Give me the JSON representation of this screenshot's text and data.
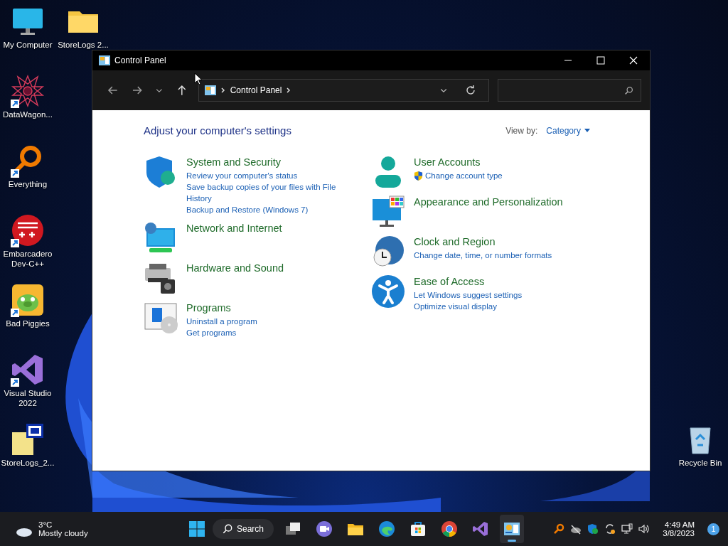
{
  "desktop_icons": [
    {
      "label": "My Computer",
      "kind": "monitor",
      "shortcut": false
    },
    {
      "label": "StoreLogs 2...",
      "kind": "folder",
      "shortcut": false
    },
    {
      "label": "DataWagon...",
      "kind": "star",
      "shortcut": true
    },
    {
      "label": "Everything",
      "kind": "magnifier",
      "shortcut": true
    },
    {
      "label": "Embarcadero Dev-C++",
      "kind": "dev",
      "shortcut": true
    },
    {
      "label": "Bad Piggies",
      "kind": "pig",
      "shortcut": true
    },
    {
      "label": "Visual Studio 2022",
      "kind": "vs",
      "shortcut": true
    },
    {
      "label": "StoreLogs_2...",
      "kind": "doc",
      "shortcut": false
    },
    {
      "label": "Recycle Bin",
      "kind": "bin",
      "shortcut": false
    }
  ],
  "window": {
    "title": "Control Panel",
    "address": {
      "crumbs": [
        "Control Panel"
      ]
    },
    "heading": "Adjust your computer's settings",
    "view_by": {
      "label": "View by:",
      "value": "Category"
    },
    "columns": [
      [
        {
          "title": "System and Security",
          "kind": "shield",
          "links": [
            {
              "text": "Review your computer's status",
              "shield": false
            },
            {
              "text": "Save backup copies of your files with File History",
              "shield": false
            },
            {
              "text": "Backup and Restore (Windows 7)",
              "shield": false
            }
          ]
        },
        {
          "title": "Network and Internet",
          "kind": "network"
        },
        {
          "title": "Hardware and Sound",
          "kind": "printer"
        },
        {
          "title": "Programs",
          "kind": "programs",
          "links": [
            {
              "text": "Uninstall a program",
              "shield": false
            },
            {
              "text": "Get programs",
              "shield": false
            }
          ]
        }
      ],
      [
        {
          "title": "User Accounts",
          "kind": "user",
          "links": [
            {
              "text": "Change account type",
              "shield": true
            }
          ]
        },
        {
          "title": "Appearance and Personalization",
          "kind": "display"
        },
        {
          "title": "Clock and Region",
          "kind": "clock",
          "links": [
            {
              "text": "Change date, time, or number formats",
              "shield": false
            }
          ]
        },
        {
          "title": "Ease of Access",
          "kind": "access",
          "links": [
            {
              "text": "Let Windows suggest settings",
              "shield": false
            },
            {
              "text": "Optimize visual display",
              "shield": false
            }
          ]
        }
      ]
    ]
  },
  "taskbar": {
    "weather": {
      "temperature": "3°C",
      "condition": "Mostly cloudy"
    },
    "search_label": "Search",
    "apps": [
      {
        "kind": "taskview",
        "selected": false
      },
      {
        "kind": "meet",
        "selected": false
      },
      {
        "kind": "explorer",
        "selected": false
      },
      {
        "kind": "edge",
        "selected": false
      },
      {
        "kind": "store",
        "selected": false
      },
      {
        "kind": "chrome",
        "selected": false
      },
      {
        "kind": "vs",
        "selected": false
      },
      {
        "kind": "controlpanel",
        "selected": true
      }
    ],
    "time": "4:49 AM",
    "date": "3/8/2023",
    "notifications": "1"
  }
}
